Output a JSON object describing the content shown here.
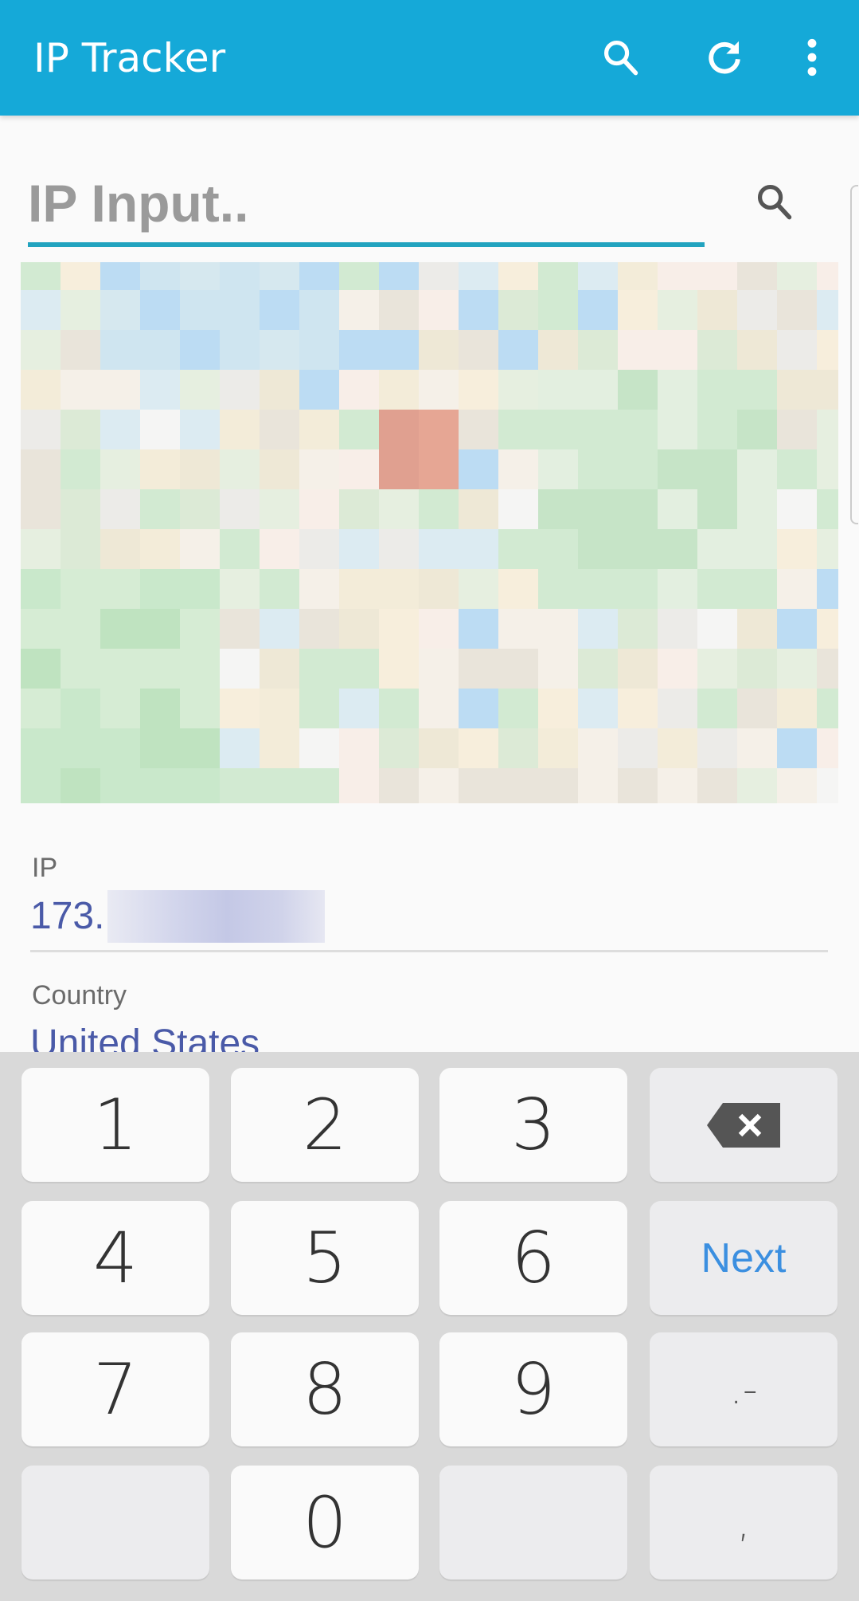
{
  "appbar": {
    "title": "IP Tracker",
    "actions": [
      {
        "icon": "search-icon"
      },
      {
        "icon": "refresh-icon"
      },
      {
        "icon": "more-vert-icon"
      }
    ],
    "color": "#15a9d8"
  },
  "search": {
    "placeholder": "IP Input..",
    "value": "",
    "button_icon": "search-icon",
    "accent": "#22a3bf"
  },
  "map": {
    "fullscreen_icon": "fullscreen-icon"
  },
  "details": [
    {
      "label": "IP",
      "value": "173."
    },
    {
      "label": "Country",
      "value": "United States"
    }
  ],
  "keyboard": {
    "keys": [
      "1",
      "2",
      "3",
      "⌫",
      "4",
      "5",
      "6",
      "Next",
      "7",
      "8",
      "9",
      ".-",
      "",
      "0",
      "",
      ","
    ],
    "next_color": "#3b8fe0"
  }
}
